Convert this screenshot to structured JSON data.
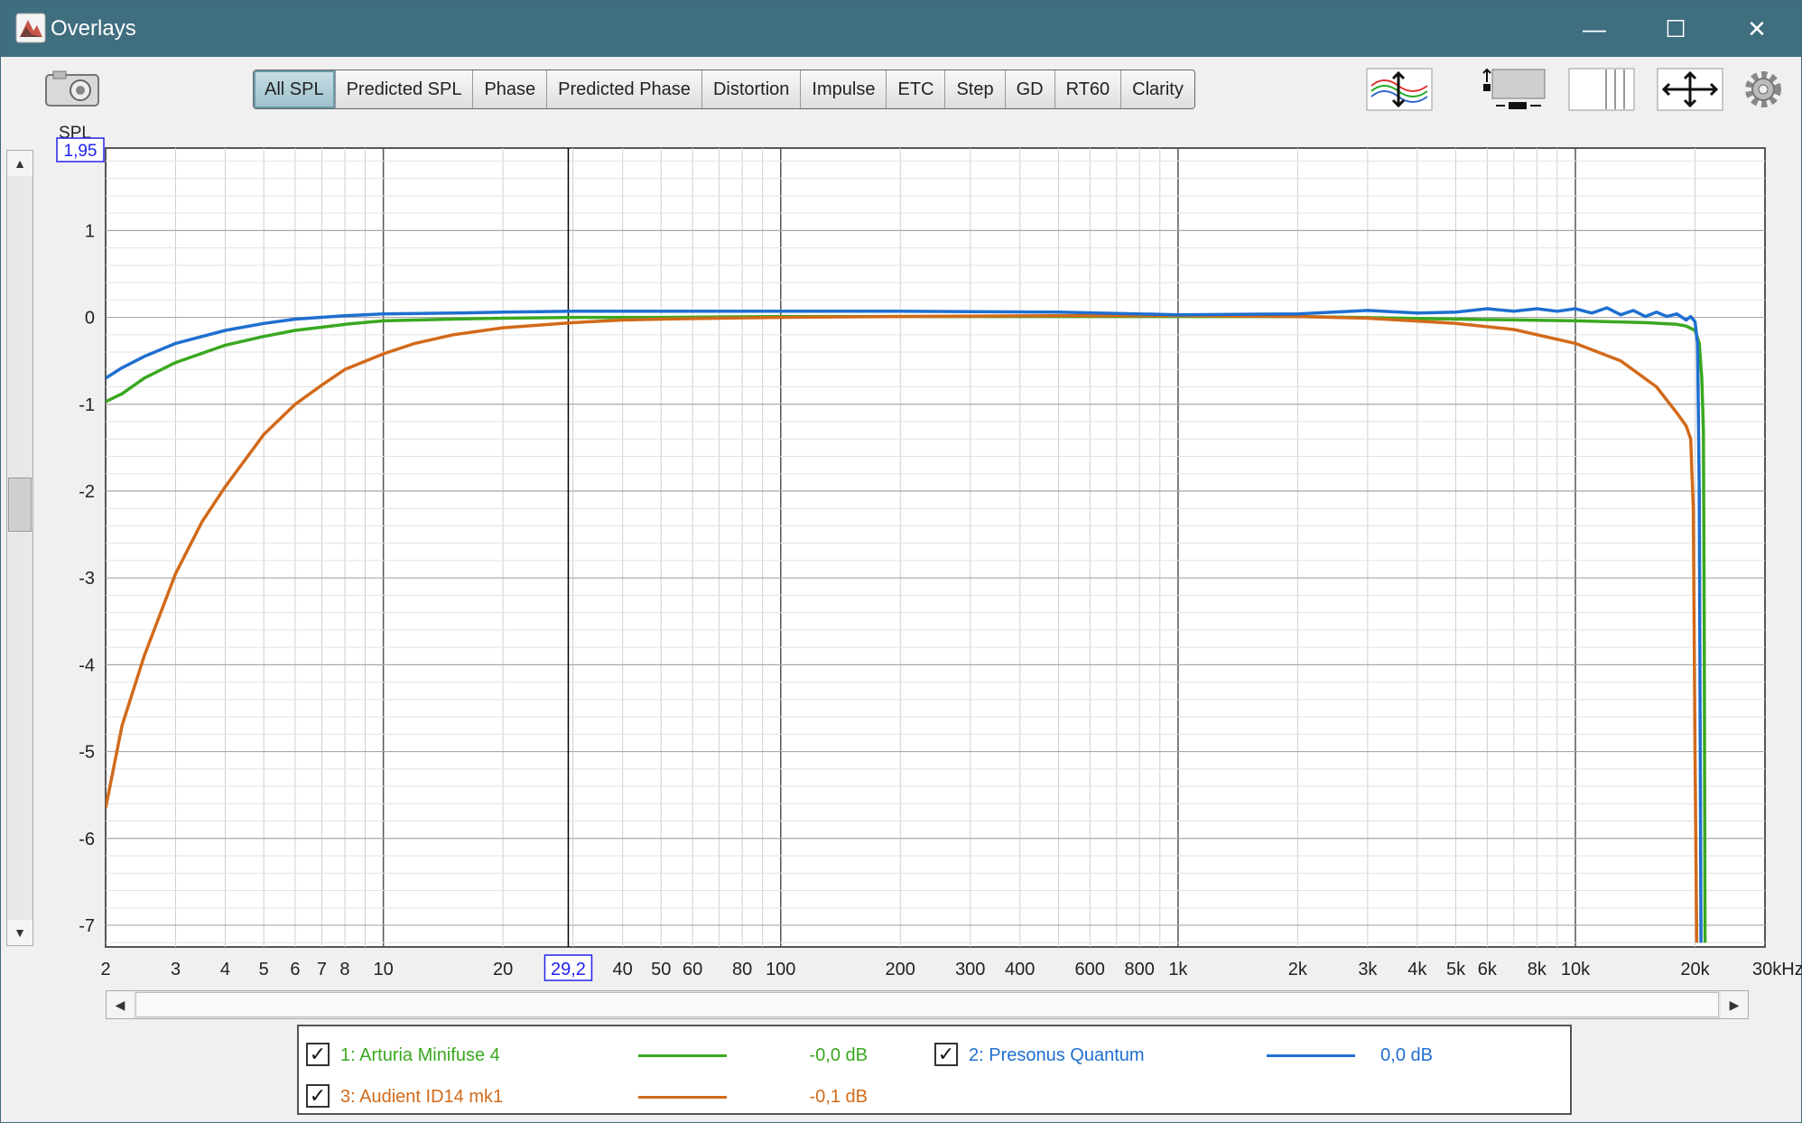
{
  "window": {
    "title": "Overlays",
    "minimize": "—",
    "maximize": "☐",
    "close": "✕"
  },
  "tabs": [
    {
      "label": "All SPL",
      "active": true
    },
    {
      "label": "Predicted SPL"
    },
    {
      "label": "Phase"
    },
    {
      "label": "Predicted Phase"
    },
    {
      "label": "Distortion"
    },
    {
      "label": "Impulse"
    },
    {
      "label": "ETC"
    },
    {
      "label": "Step"
    },
    {
      "label": "GD"
    },
    {
      "label": "RT60"
    },
    {
      "label": "Clarity"
    }
  ],
  "icons": [
    "camera-icon",
    "traces-arrange-icon",
    "graph-size-icon",
    "split-view-icon",
    "pan-arrows-icon",
    "settings-gear-icon"
  ],
  "cursor": {
    "y_readout": "1,95",
    "x_readout": "29,2",
    "x_value": 29.2
  },
  "chart_data": {
    "type": "line",
    "xscale": "log",
    "xlim": [
      2,
      30000
    ],
    "ylim": [
      -7.25,
      1.95
    ],
    "ylabel": "SPL",
    "yticks": [
      1,
      0,
      -1,
      -2,
      -3,
      -4,
      -5,
      -6,
      -7
    ],
    "ytick_labels": [
      "1",
      "0",
      "-1",
      "-2",
      "-3",
      "-4",
      "-5",
      "-6",
      "-7"
    ],
    "xticks": [
      2,
      3,
      4,
      5,
      6,
      7,
      8,
      10,
      20,
      40,
      50,
      60,
      80,
      100,
      200,
      300,
      400,
      600,
      800,
      1000,
      2000,
      3000,
      4000,
      5000,
      6000,
      8000,
      10000,
      20000
    ],
    "xtick_labels": [
      "2",
      "3",
      "4",
      "5",
      "6",
      "7",
      "8",
      "10",
      "20",
      "40",
      "50",
      "60",
      "80",
      "100",
      "200",
      "300",
      "400",
      "600",
      "800",
      "1k",
      "2k",
      "3k",
      "4k",
      "5k",
      "6k",
      "8k",
      "10k",
      "20k"
    ],
    "x_end_label": "30kHz",
    "grid": true,
    "series": [
      {
        "name": "1: Arturia Minifuse 4",
        "color": "#3aa820",
        "offset_label": "-0,0 dB",
        "checked": true,
        "x": [
          2,
          2.2,
          2.5,
          3,
          4,
          5,
          6,
          8,
          10,
          15,
          20,
          30,
          50,
          100,
          200,
          500,
          1000,
          2000,
          5000,
          10000,
          15000,
          18000,
          19000,
          20000,
          20500,
          20800,
          21000,
          21100,
          21200
        ],
        "y": [
          -0.97,
          -0.88,
          -0.7,
          -0.52,
          -0.32,
          -0.22,
          -0.15,
          -0.08,
          -0.04,
          -0.02,
          -0.01,
          0,
          0,
          0.01,
          0.01,
          0.01,
          0.01,
          0.01,
          -0.02,
          -0.04,
          -0.06,
          -0.08,
          -0.1,
          -0.15,
          -0.3,
          -0.7,
          -1.3,
          -3.5,
          -7.2
        ]
      },
      {
        "name": "2: Presonus Quantum",
        "color": "#1f6fd0",
        "offset_label": "0,0 dB",
        "checked": true,
        "x": [
          2,
          2.2,
          2.5,
          3,
          4,
          5,
          6,
          8,
          10,
          15,
          20,
          30,
          50,
          100,
          200,
          500,
          1000,
          2000,
          3000,
          4000,
          5000,
          6000,
          7000,
          8000,
          9000,
          10000,
          11000,
          12000,
          13000,
          14000,
          15000,
          16000,
          17000,
          18000,
          19000,
          19500,
          20000,
          20300,
          20500,
          20700
        ],
        "y": [
          -0.7,
          -0.58,
          -0.45,
          -0.3,
          -0.15,
          -0.07,
          -0.02,
          0.02,
          0.04,
          0.05,
          0.06,
          0.07,
          0.07,
          0.07,
          0.07,
          0.06,
          0.03,
          0.04,
          0.08,
          0.05,
          0.06,
          0.1,
          0.07,
          0.1,
          0.07,
          0.1,
          0.05,
          0.11,
          0.03,
          0.08,
          0.01,
          0.06,
          0.01,
          0.04,
          -0.03,
          0.01,
          -0.05,
          -0.3,
          -2,
          -7.2
        ]
      },
      {
        "name": "3: Audient ID14 mk1",
        "color": "#d26a1a",
        "offset_label": "-0,1 dB",
        "checked": true,
        "x": [
          2,
          2.2,
          2.5,
          3,
          3.5,
          4,
          5,
          6,
          7,
          8,
          10,
          12,
          15,
          20,
          30,
          40,
          50,
          70,
          100,
          200,
          500,
          1000,
          2000,
          3000,
          5000,
          7000,
          10000,
          13000,
          16000,
          18000,
          19000,
          19500,
          19800,
          20000,
          20200
        ],
        "y": [
          -5.65,
          -4.7,
          -3.9,
          -2.95,
          -2.35,
          -1.95,
          -1.35,
          -1.0,
          -0.78,
          -0.6,
          -0.42,
          -0.3,
          -0.2,
          -0.12,
          -0.06,
          -0.03,
          -0.02,
          -0.01,
          0,
          0.01,
          0.02,
          0.02,
          0.01,
          -0.01,
          -0.07,
          -0.14,
          -0.3,
          -0.5,
          -0.8,
          -1.1,
          -1.25,
          -1.4,
          -2.2,
          -5,
          -7.2
        ]
      }
    ]
  }
}
